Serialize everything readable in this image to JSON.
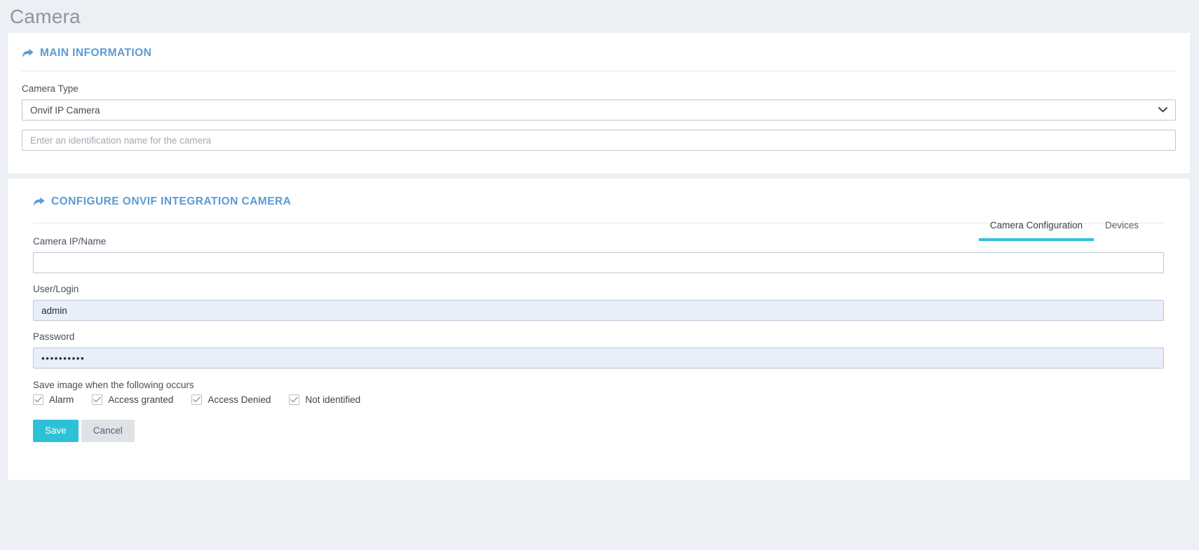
{
  "page": {
    "title": "Camera",
    "background_color": "#eceff4"
  },
  "theme": {
    "accent_teal": "#2ec1d6",
    "header_blue": "#5b9bd5",
    "autofill_blue": "#e8effa",
    "card_white": "#ffffff"
  },
  "main_information": {
    "header": "MAIN INFORMATION",
    "header_icon": "forward-arrow-icon",
    "camera_type": {
      "label": "Camera Type",
      "value": "Onvif IP Camera",
      "options": [
        "Onvif IP Camera"
      ],
      "chevron_icon": "chevron-down-icon"
    },
    "camera_name": {
      "value": "",
      "placeholder": "Enter an identification name for the camera"
    }
  },
  "onvif_section": {
    "header": "CONFIGURE ONVIF INTEGRATION CAMERA",
    "header_icon": "forward-arrow-icon",
    "tabs": [
      {
        "label": "Camera Configuration",
        "active": true
      },
      {
        "label": "Devices",
        "active": false
      }
    ],
    "fields": {
      "camera_ip": {
        "label": "Camera IP/Name",
        "value": "",
        "placeholder": ""
      },
      "user_login": {
        "label": "User/Login",
        "value": "admin",
        "placeholder": ""
      },
      "password": {
        "label": "Password",
        "value": "••••••••••",
        "placeholder": ""
      }
    },
    "save_image": {
      "label": "Save image when the following occurs",
      "options": [
        {
          "label": "Alarm",
          "checked": true
        },
        {
          "label": "Access granted",
          "checked": true
        },
        {
          "label": "Access Denied",
          "checked": true
        },
        {
          "label": "Not identified",
          "checked": true
        }
      ]
    },
    "buttons": {
      "save": "Save",
      "cancel": "Cancel"
    }
  }
}
